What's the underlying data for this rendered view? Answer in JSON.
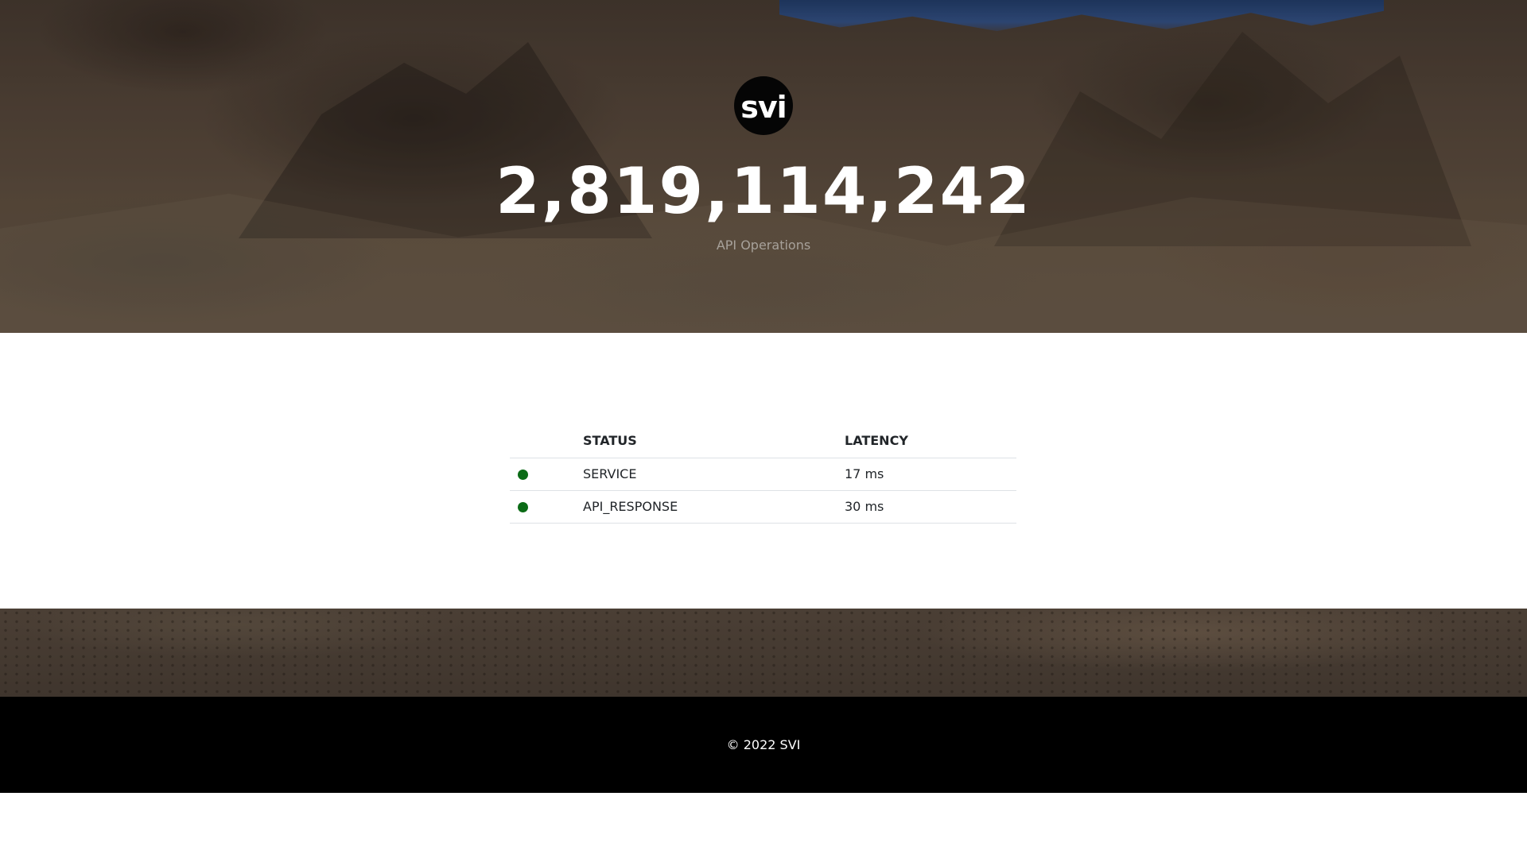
{
  "hero": {
    "logo_text": "svi",
    "counter_value": "2,819,114,242",
    "counter_label": "API Operations"
  },
  "status_table": {
    "headers": [
      "",
      "STATUS",
      "LATENCY"
    ],
    "rows": [
      {
        "indicator_color": "#0b6b16",
        "name": "SERVICE",
        "latency": "17 ms"
      },
      {
        "indicator_color": "#0b6b16",
        "name": "API_RESPONSE",
        "latency": "30 ms"
      }
    ]
  },
  "footer": {
    "copyright": "© 2022 SVI"
  }
}
